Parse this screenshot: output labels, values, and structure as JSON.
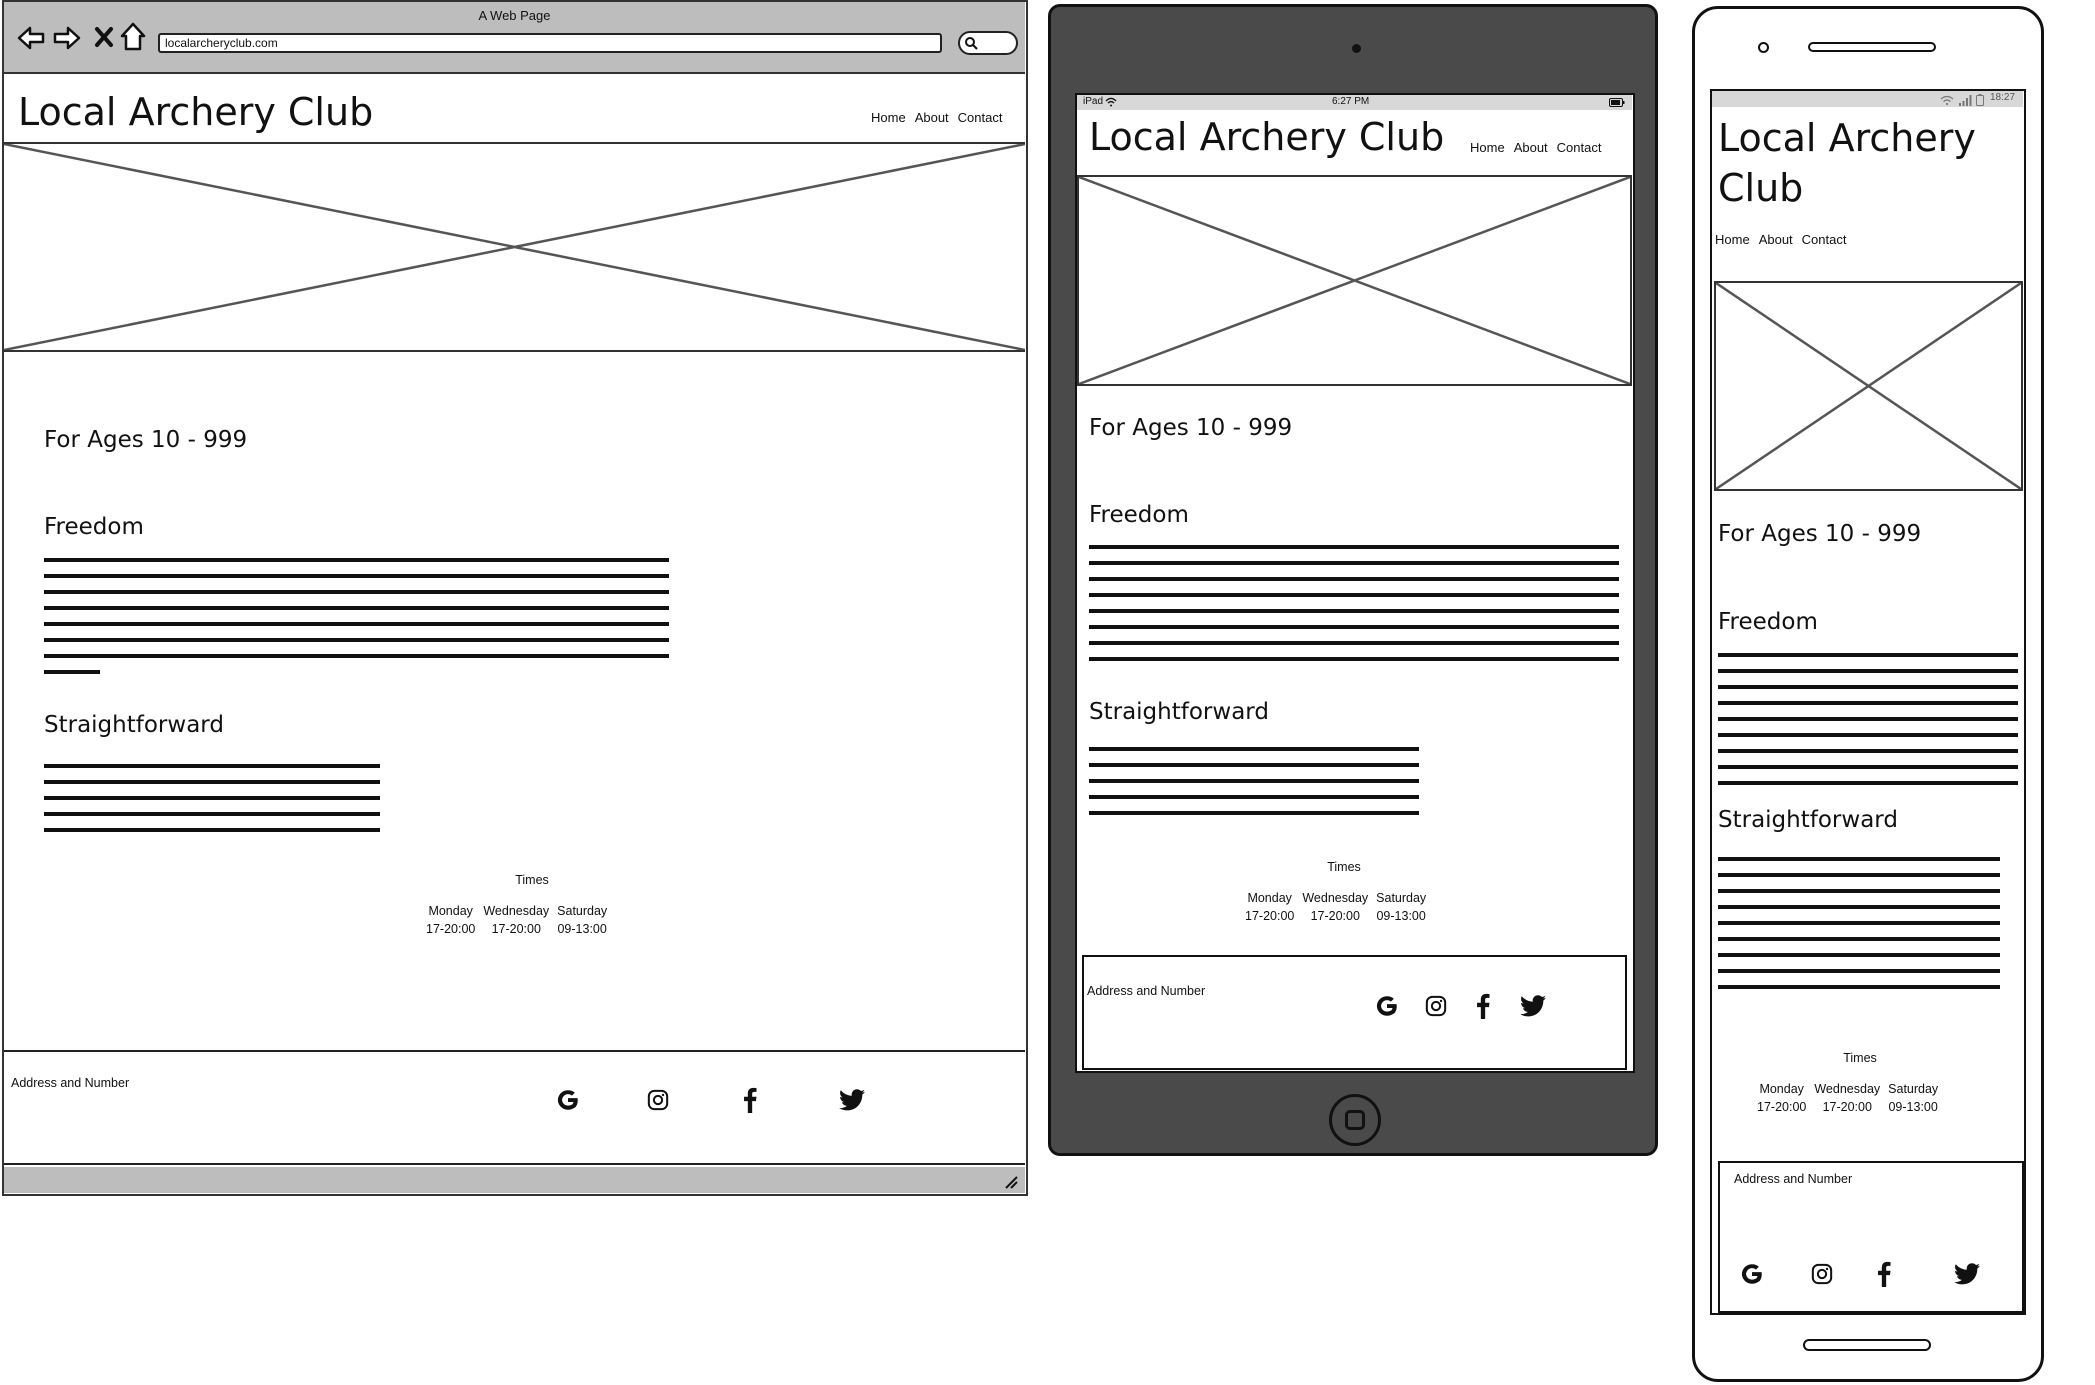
{
  "browser": {
    "window_title": "A Web Page",
    "url": "localarcheryclub.com"
  },
  "site": {
    "name": "Local Archery Club",
    "nav": [
      "Home",
      "About",
      "Contact"
    ],
    "ages": "For Ages 10 - 999",
    "sections": [
      {
        "heading": "Freedom"
      },
      {
        "heading": "Straightforward"
      }
    ],
    "times": {
      "title": "Times",
      "days": [
        "Monday",
        "Wednesday",
        "Saturday"
      ],
      "hours": [
        "17-20:00",
        "17-20:00",
        "09-13:00"
      ]
    },
    "footer": {
      "address": "Address and Number",
      "social_icons": [
        "google-icon",
        "instagram-icon",
        "facebook-icon",
        "twitter-icon"
      ]
    }
  },
  "tablet": {
    "status_left": "iPad",
    "status_time": "6:27 PM"
  },
  "phone": {
    "status_time": "18:27"
  }
}
